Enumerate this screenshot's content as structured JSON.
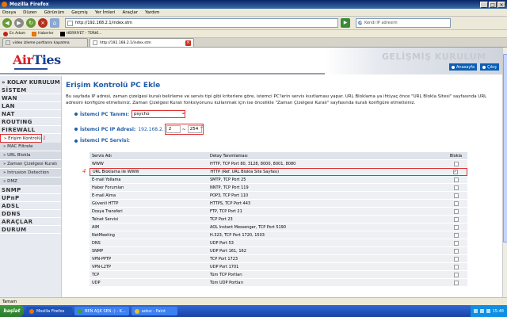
{
  "window": {
    "title": "Mozilla Firefox"
  },
  "menu": [
    "Dosya",
    "Düzen",
    "Görünüm",
    "Geçmiş",
    "Yer İmleri",
    "Araçlar",
    "Yardım"
  ],
  "nav": {
    "url": "http://192.168.2.1/index.stm",
    "search_placeholder": "Kendi IP adresim",
    "search_engine": "G"
  },
  "bookmarks": [
    "En Adam",
    "Haberler",
    "HÜRRİYET - TÜRKİ..."
  ],
  "tabs": [
    {
      "label": "video izleme portlarını kapatma"
    },
    {
      "label": "http://192.168.2.1/index.stm"
    }
  ],
  "header": {
    "logo_prefix": "Air",
    "logo_suffix": "Ties",
    "title": "GELİŞMİŞ KURULUM",
    "links": [
      "Anasayfa",
      "Çıkış"
    ]
  },
  "sidebar": {
    "header": "» KOLAY KURULUM",
    "items": [
      {
        "label": "SİSTEM"
      },
      {
        "label": "WAN"
      },
      {
        "label": "LAN"
      },
      {
        "label": "NAT"
      },
      {
        "label": "ROUTING"
      },
      {
        "label": "FIREWALL"
      }
    ],
    "subitems": [
      {
        "label": "» Erişim Kontrolü"
      },
      {
        "label": "» MAC Filtrele"
      },
      {
        "label": "» URL Blokla"
      },
      {
        "label": "» Zaman Çizelgesi Kuralı"
      },
      {
        "label": "» Intrusion Detection"
      },
      {
        "label": "» DMZ"
      }
    ],
    "items_after": [
      {
        "label": "SNMP"
      },
      {
        "label": "UPnP"
      },
      {
        "label": "ADSL"
      },
      {
        "label": "DDNS"
      },
      {
        "label": "ARAÇLAR"
      },
      {
        "label": "DURUM"
      }
    ],
    "anno_1": "1"
  },
  "main": {
    "title": "Erişim Kontrolü PC Ekle",
    "description": "Bu sayfada IP adresi, zaman çizelgesi kuralı belirleme ve servis tipi gibi kriterlere göre, istemci PC'lerin servis kısıtlaması yapar. URL Bloklama ya ihtiyaç önce \"URL Blokla Sitesi\" sayfasında URL adresini konfigüre etmelisiniz. Zaman Çizelgesi Kuralı fonksiyonunu kullanmak için ise öncelikle \"Zaman Çizelgesi Kuralı\" sayfasında kuralı konfigüre etmelisiniz.",
    "pc_desc_label": "İstemci PC Tanımı:",
    "pc_desc_value": "psycho",
    "ip_label": "İstemci PC IP Adresi:",
    "ip_prefix": "192.168.2.",
    "ip_start": "2",
    "ip_sep": "~",
    "ip_end": "254",
    "service_label": "İstemci PC Servisi:",
    "anno_2": "2",
    "anno_3": "3",
    "anno_4": "4"
  },
  "services": {
    "headers": [
      "Servis Adı",
      "Detay Tanımlaması",
      "Blokla"
    ],
    "rows": [
      {
        "name": "WWW",
        "detail": "HTTP, TCP Port 80, 3128, 8000, 8001, 8080",
        "checked": false
      },
      {
        "name": "URL Bloklama ile WWW",
        "detail": "HTTP (Ref. URL Blokla Site Sayfası)",
        "checked": true
      },
      {
        "name": "E-mail Yollama",
        "detail": "SMTP, TCP Port 25",
        "checked": false
      },
      {
        "name": "Haber Forumları",
        "detail": "NNTP, TCP Port 119",
        "checked": false
      },
      {
        "name": "E-mail Alma",
        "detail": "POP3, TCP Port 110",
        "checked": false
      },
      {
        "name": "Güvenli HTTP",
        "detail": "HTTPS, TCP Port 443",
        "checked": false
      },
      {
        "name": "Dosya Transferi",
        "detail": "FTP, TCP Port 21",
        "checked": false
      },
      {
        "name": "Telnet Servisi",
        "detail": "TCP Port 23",
        "checked": false
      },
      {
        "name": "AIM",
        "detail": "AOL Instant Messenger, TCP Port 5190",
        "checked": false
      },
      {
        "name": "NetMeeting",
        "detail": "H.323, TCP Port 1720, 1503",
        "checked": false
      },
      {
        "name": "DNS",
        "detail": "UDP Port 53",
        "checked": false
      },
      {
        "name": "SNMP",
        "detail": "UDP Port 161, 162",
        "checked": false
      },
      {
        "name": "VPN-PPTP",
        "detail": "TCP Port 1723",
        "checked": false
      },
      {
        "name": "VPN-L2TP",
        "detail": "UDP Port 1701",
        "checked": false
      },
      {
        "name": "TCP",
        "detail": "Tüm TCP Portları",
        "checked": false
      },
      {
        "name": "UDP",
        "detail": "Tüm UDP Portları",
        "checked": false
      }
    ]
  },
  "status": {
    "text": "Tamam"
  },
  "taskbar": {
    "start": "başlat",
    "tasks": [
      "Mozilla Firefox",
      "BEN AŞK SEN :) - K...",
      "adsız - Paint"
    ],
    "clock": "15:48"
  },
  "colors": {
    "accent": "#1f5ca8",
    "annotation": "#e03030",
    "logo_red": "#d82028",
    "logo_blue": "#1a3f8f"
  }
}
